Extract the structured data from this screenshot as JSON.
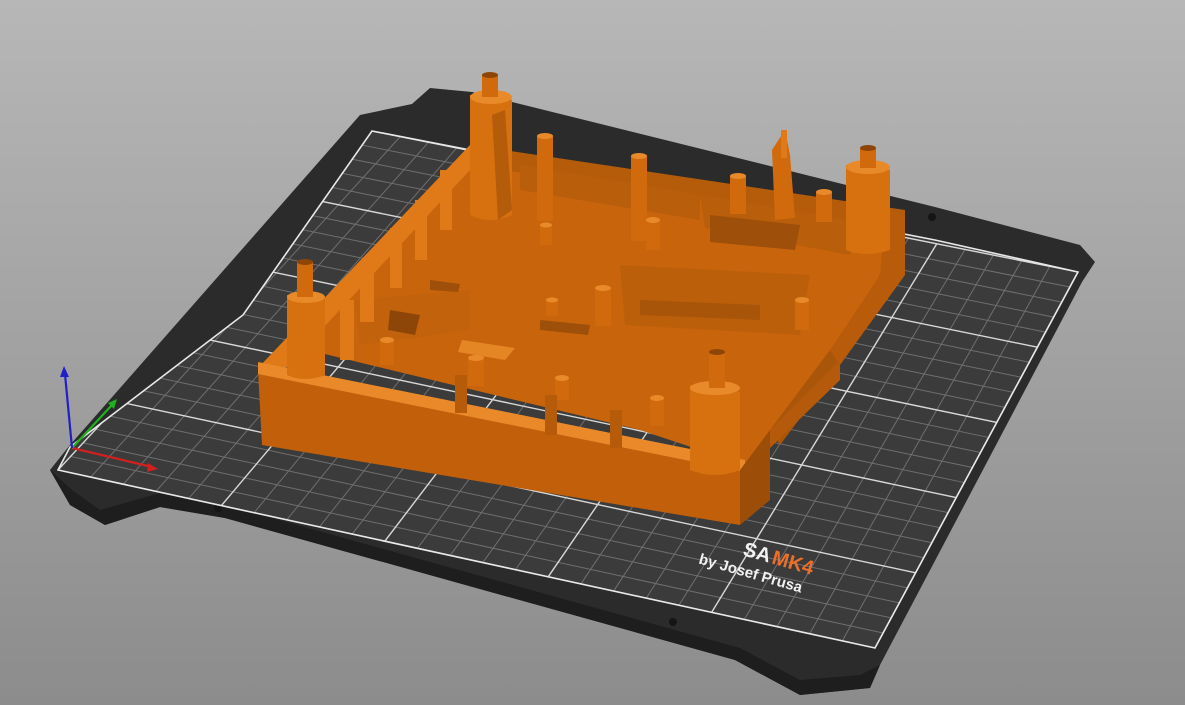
{
  "bed": {
    "brand_prefix": "SA",
    "brand_model": "MK4",
    "brand_byline": "by Josef Prusa"
  },
  "colors": {
    "background_top": "#b5b5b5",
    "background_bottom": "#8e8e8e",
    "sheet": "#2a2a2a",
    "plate": "#3a3a3a",
    "grid": "#707070",
    "grid_major": "#e8e8e8",
    "model": "#d9700e",
    "model_dark": "#a5520a",
    "model_light": "#e98a2a",
    "accent_text": "#e8702a",
    "axis_x": "#d02020",
    "axis_y": "#20b020",
    "axis_z": "#2020c8"
  },
  "icons": {
    "axes": "xyz-axes-icon",
    "model": "3d-model-object"
  }
}
